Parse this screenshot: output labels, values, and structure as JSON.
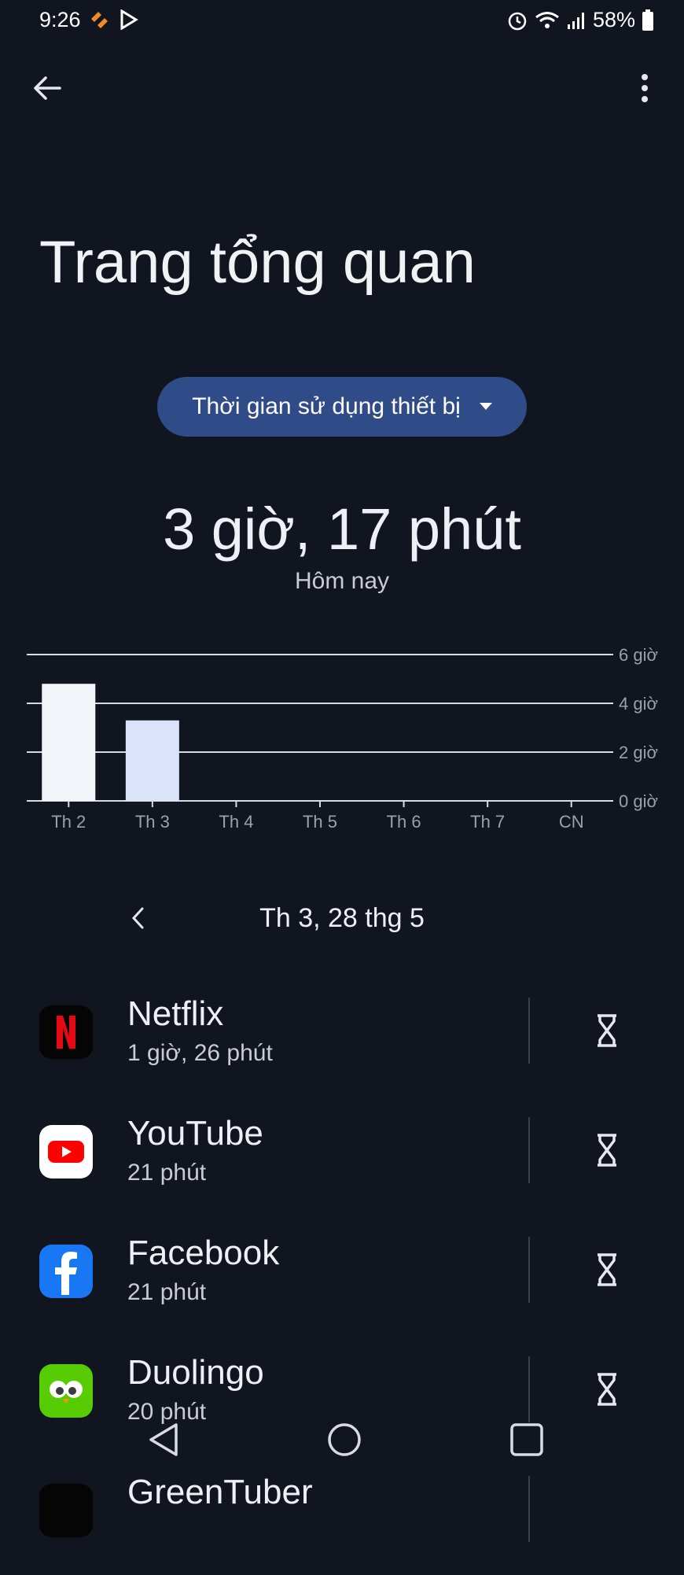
{
  "status_bar": {
    "time": "9:26",
    "battery": "58%"
  },
  "header": {
    "title": "Trang tổng quan"
  },
  "selector": {
    "label": "Thời gian sử dụng thiết bị"
  },
  "summary": {
    "total": "3 giờ, 17 phút",
    "period": "Hôm nay"
  },
  "chart_data": {
    "type": "bar",
    "categories": [
      "Th 2",
      "Th 3",
      "Th 4",
      "Th 5",
      "Th 6",
      "Th 7",
      "CN"
    ],
    "values": [
      4.8,
      3.3,
      0,
      0,
      0,
      0,
      0
    ],
    "unit": "giờ",
    "ylim": [
      0,
      6
    ],
    "y_ticks": [
      {
        "value": 6,
        "label": "6 giờ"
      },
      {
        "value": 4,
        "label": "4 giờ"
      },
      {
        "value": 2,
        "label": "2 giờ"
      },
      {
        "value": 0,
        "label": "0 giờ"
      }
    ],
    "grid": true,
    "bar_colors": [
      "#f3f5fb",
      "#dbe3fb"
    ]
  },
  "date_nav": {
    "label": "Th 3, 28 thg 5"
  },
  "apps": [
    {
      "name": "Netflix",
      "time": "1 giờ, 26 phút",
      "icon": "netflix-icon"
    },
    {
      "name": "YouTube",
      "time": "21 phút",
      "icon": "youtube-icon"
    },
    {
      "name": "Facebook",
      "time": "21 phút",
      "icon": "facebook-icon"
    },
    {
      "name": "Duolingo",
      "time": "20 phút",
      "icon": "duolingo-icon"
    },
    {
      "name": "GreenTuber",
      "time": "",
      "icon": "greentuber-icon"
    }
  ]
}
